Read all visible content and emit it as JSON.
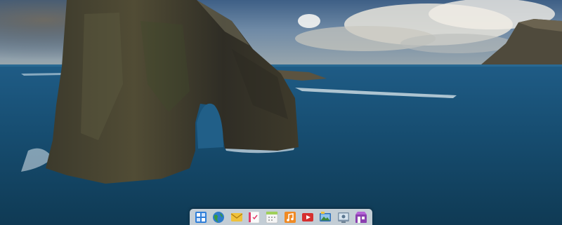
{
  "desktop": {
    "wallpaper": "sea-arch-wallpaper"
  },
  "dock": {
    "items": [
      {
        "icon": "multitasking-view-icon",
        "color": "#2f7fd9"
      },
      {
        "icon": "web-browser-icon",
        "color": "#3a9a3f"
      },
      {
        "icon": "mail-icon",
        "color": "#f0c23a"
      },
      {
        "icon": "tasks-icon",
        "color": "#e23b6a"
      },
      {
        "icon": "calendar-icon",
        "color": "#f5f5f5"
      },
      {
        "icon": "music-icon",
        "color": "#f08a24"
      },
      {
        "icon": "videos-icon",
        "color": "#d62f2f"
      },
      {
        "icon": "photos-icon",
        "color": "#2d6fb8"
      },
      {
        "icon": "system-settings-icon",
        "color": "#7d93a8"
      },
      {
        "icon": "app-center-icon",
        "color": "#8b3fb0"
      }
    ]
  }
}
